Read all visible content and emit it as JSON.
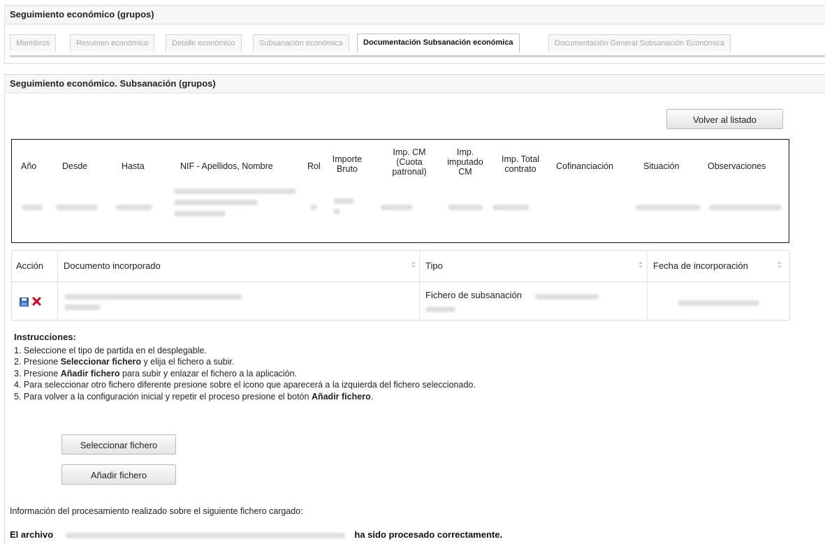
{
  "panel1": {
    "title": "Seguimiento económico (grupos)",
    "tabs": [
      {
        "label": "Miembros"
      },
      {
        "label": "Resumen económico"
      },
      {
        "label": "Detalle económico"
      },
      {
        "label": "Subsanación económica"
      },
      {
        "label": "Documentación Subsanación económica",
        "active": true
      },
      {
        "label": "Documentación General Subsanación Económica"
      }
    ]
  },
  "panel2": {
    "title": "Seguimiento económico. Subsanación (grupos)",
    "back_button": "Volver al listado"
  },
  "summary": {
    "headers": {
      "anio": "Año",
      "desde": "Desde",
      "hasta": "Hasta",
      "nif": "NIF - Apellidos, Nombre",
      "rol": "Rol",
      "importe_1": "Importe",
      "importe_2": "Bruto",
      "impcm_1": "Imp. CM",
      "impcm_2": "(Cuota",
      "impcm_3": "patronal)",
      "impimp_1": "Imp.",
      "impimp_2": "imputado",
      "impimp_3": "CM",
      "imptot_1": "Imp. Total",
      "imptot_2": "contrato",
      "cofin": "Cofinanciación",
      "situacion": "Situación",
      "obs": "Observaciones"
    }
  },
  "documents": {
    "headers": {
      "accion": "Acción",
      "documento": "Documento incorporado",
      "tipo": "Tipo",
      "fecha": "Fecha de incorporación"
    },
    "rows": [
      {
        "tipo": "Fichero de subsanación"
      }
    ]
  },
  "instructions": {
    "title": "Instrucciones:",
    "s1": "1. Seleccione el tipo de partida en el desplegable.",
    "s2_a": "2. Presione ",
    "s2_b": "Seleccionar fichero",
    "s2_c": " y elija el fichero a subir.",
    "s3_a": "3. Presione ",
    "s3_b": "Añadir fichero",
    "s3_c": " para subir y enlazar el fichero a la aplicación.",
    "s4": "4. Para seleccionar otro fichero diferente presione sobre el icono que aparecerá a la izquierda del fichero seleccionado.",
    "s5_a": "5. Para volver a la configuración inicial y repetir el proceso presione el botón ",
    "s5_b": "Añadir fichero",
    "s5_c": "."
  },
  "buttons": {
    "select_file": "Seleccionar fichero",
    "add_file": "Añadir fichero"
  },
  "processing": {
    "info": "Información del procesamiento realizado sobre el siguiente fichero cargado:",
    "result_prefix": "El archivo",
    "result_suffix": "ha sido procesado correctamente."
  },
  "colors": {
    "delete_icon": "#d0021b",
    "save_icon": "#2a5db0"
  }
}
